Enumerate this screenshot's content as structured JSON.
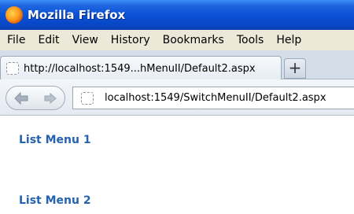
{
  "window": {
    "title": "Mozilla Firefox",
    "icon": "firefox-icon"
  },
  "menubar": {
    "items": [
      "File",
      "Edit",
      "View",
      "History",
      "Bookmarks",
      "Tools",
      "Help"
    ]
  },
  "tabs": [
    {
      "label": "http://localhost:1549...hMenuII/Default2.aspx",
      "icon": "page-icon"
    }
  ],
  "new_tab_label": "+",
  "navbar": {
    "back_icon": "back-arrow-icon",
    "forward_icon": "forward-arrow-icon",
    "url": "localhost:1549/SwitchMenuII/Default2.aspx"
  },
  "page": {
    "menus": [
      "List Menu 1",
      "List Menu 2"
    ]
  },
  "colors": {
    "titlebar": "#0a52d6",
    "link": "#2563b0",
    "menubar": "#ece9d8"
  }
}
